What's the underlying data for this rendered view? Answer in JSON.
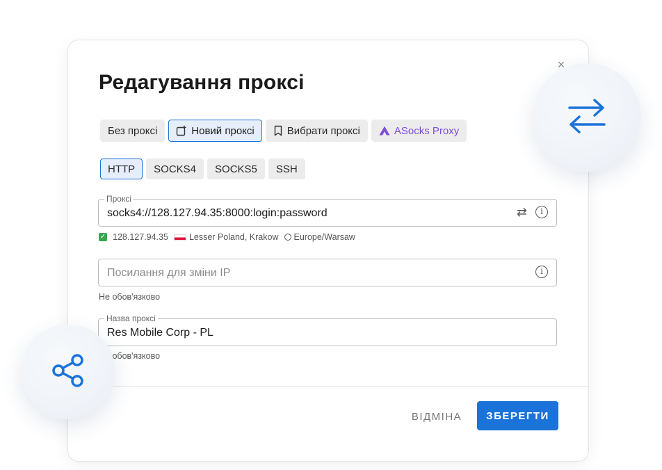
{
  "dialog": {
    "title": "Редагування проксі",
    "close_icon": "close-icon",
    "tabs": [
      {
        "label": "Без проксі",
        "icon": "",
        "active": false
      },
      {
        "label": "Новий проксі",
        "icon": "add-square-icon",
        "active": true
      },
      {
        "label": "Вибрати проксі",
        "icon": "bookmark-icon",
        "active": false
      },
      {
        "label": "ASocks Proxy",
        "icon": "asocks-logo-icon",
        "active": false
      }
    ],
    "protocols": [
      {
        "label": "HTTP",
        "active": true
      },
      {
        "label": "SOCKS4",
        "active": false
      },
      {
        "label": "SOCKS5",
        "active": false
      },
      {
        "label": "SSH",
        "active": false
      }
    ],
    "proxy_field": {
      "legend": "Проксі",
      "value": "socks4://128.127.94.35:8000:login:password"
    },
    "proxy_meta": {
      "ip": "128.127.94.35",
      "location": "Lesser Poland, Krakow",
      "timezone": "Europe/Warsaw",
      "status_color": "#3aa54a"
    },
    "change_ip_field": {
      "placeholder": "Посилання для зміни IP",
      "helper": "Не обов'язково"
    },
    "name_field": {
      "legend": "Назва проксі",
      "value": "Res Mobile Corp - PL",
      "helper": "Не обов'язково"
    },
    "buttons": {
      "cancel": "ВІДМІНА",
      "save": "ЗБЕРЕГТИ"
    }
  },
  "colors": {
    "accent": "#1a73d9",
    "asocks": "#7c4ddb"
  },
  "bubbles": {
    "right_icon": "swap-arrows-icon",
    "left_icon": "share-icon"
  }
}
